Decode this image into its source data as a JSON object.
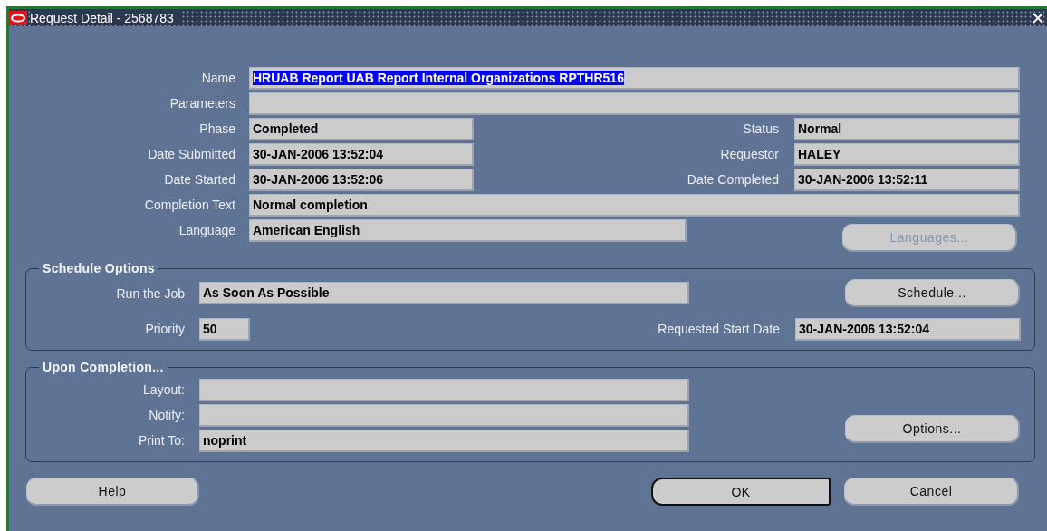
{
  "window": {
    "title": "Request Detail - 2568783"
  },
  "request_rows": [
    {
      "kind": "wide",
      "fields": [
        {
          "label": "Name",
          "value": "HRUAB Report UAB Report Internal Organizations RPTHR516",
          "highlighted": true
        }
      ]
    },
    {
      "kind": "wide",
      "fields": [
        {
          "label": "Parameters"
        }
      ]
    },
    {
      "kind": "pair",
      "fields": [
        {
          "label": "Phase",
          "value": "Completed",
          "highlighted": false
        },
        {
          "label": "Status",
          "value": "Normal",
          "highlighted": false
        }
      ]
    },
    {
      "kind": "pair",
      "fields": [
        {
          "label": "Date Submitted",
          "value": "30-JAN-2006 13:52:04",
          "highlighted": false
        },
        {
          "label": "Requestor",
          "value": "HALEY",
          "highlighted": false
        }
      ]
    },
    {
      "kind": "pair",
      "fields": [
        {
          "label": "Date Started",
          "value": "30-JAN-2006 13:52:06",
          "highlighted": false
        },
        {
          "label": "Date Completed",
          "value": "30-JAN-2006 13:52:11",
          "highlighted": false
        }
      ]
    },
    {
      "kind": "wide",
      "fields": [
        {
          "label": "Completion Text",
          "value": "Normal completion",
          "highlighted": false
        }
      ]
    },
    {
      "kind": "medium",
      "fields": [
        {
          "label": "Language",
          "value": "American English",
          "highlighted": false
        }
      ],
      "button": {
        "label": "Languages...",
        "disabled": true
      }
    }
  ],
  "schedule_options": {
    "title": "Schedule Options",
    "run_the_job": {
      "label": "Run the Job",
      "value": "As Soon As Possible"
    },
    "schedule_button": {
      "label": "Schedule...",
      "disabled": false
    },
    "priority": {
      "label": "Priority",
      "value": "50"
    },
    "requested_start_date": {
      "label": "Requested Start Date",
      "value": "30-JAN-2006 13:52:04"
    }
  },
  "upon_completion": {
    "title": "Upon Completion...",
    "fields": [
      {
        "label": "Layout:"
      },
      {
        "label": "Notify:"
      },
      {
        "label": "Print To:",
        "value": "noprint"
      }
    ],
    "options_button": {
      "label": "Options...",
      "disabled": false
    }
  },
  "buttons": [
    {
      "kind": "help",
      "label": "Help",
      "default": false
    },
    {
      "kind": "ok",
      "label": "OK",
      "default": true
    },
    {
      "kind": "cancel",
      "label": "Cancel",
      "default": false
    }
  ]
}
